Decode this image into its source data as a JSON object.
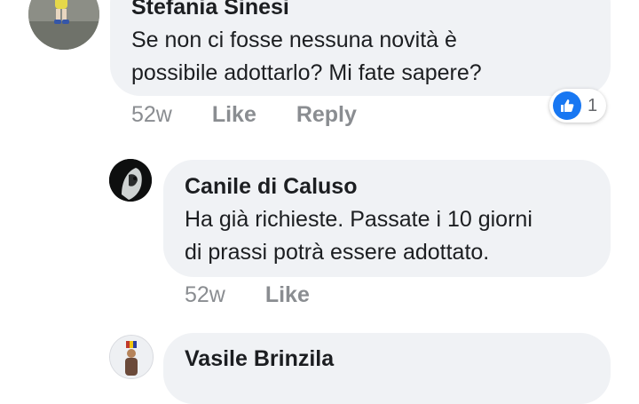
{
  "comments": [
    {
      "author": "Stefania Sinesi",
      "text_lines": [
        "Se non ci fosse nessuna novità è",
        "possibile adottarlo? Mi fate sapere?"
      ],
      "time": "52w",
      "like_label": "Like",
      "reply_label": "Reply",
      "reaction": {
        "icon": "thumbs-up-icon",
        "count": "1"
      }
    },
    {
      "author": "Canile di Caluso",
      "text_lines": [
        "Ha già richieste. Passate i 10 giorni",
        "di prassi potrà essere adottato."
      ],
      "time": "52w",
      "like_label": "Like"
    },
    {
      "author": "Vasile Brinzila"
    }
  ],
  "colors": {
    "bubble": "#f0f2f5",
    "meta_text": "#8a8d91",
    "like_blue": "#1877f2",
    "author_text": "#1c1e21"
  }
}
